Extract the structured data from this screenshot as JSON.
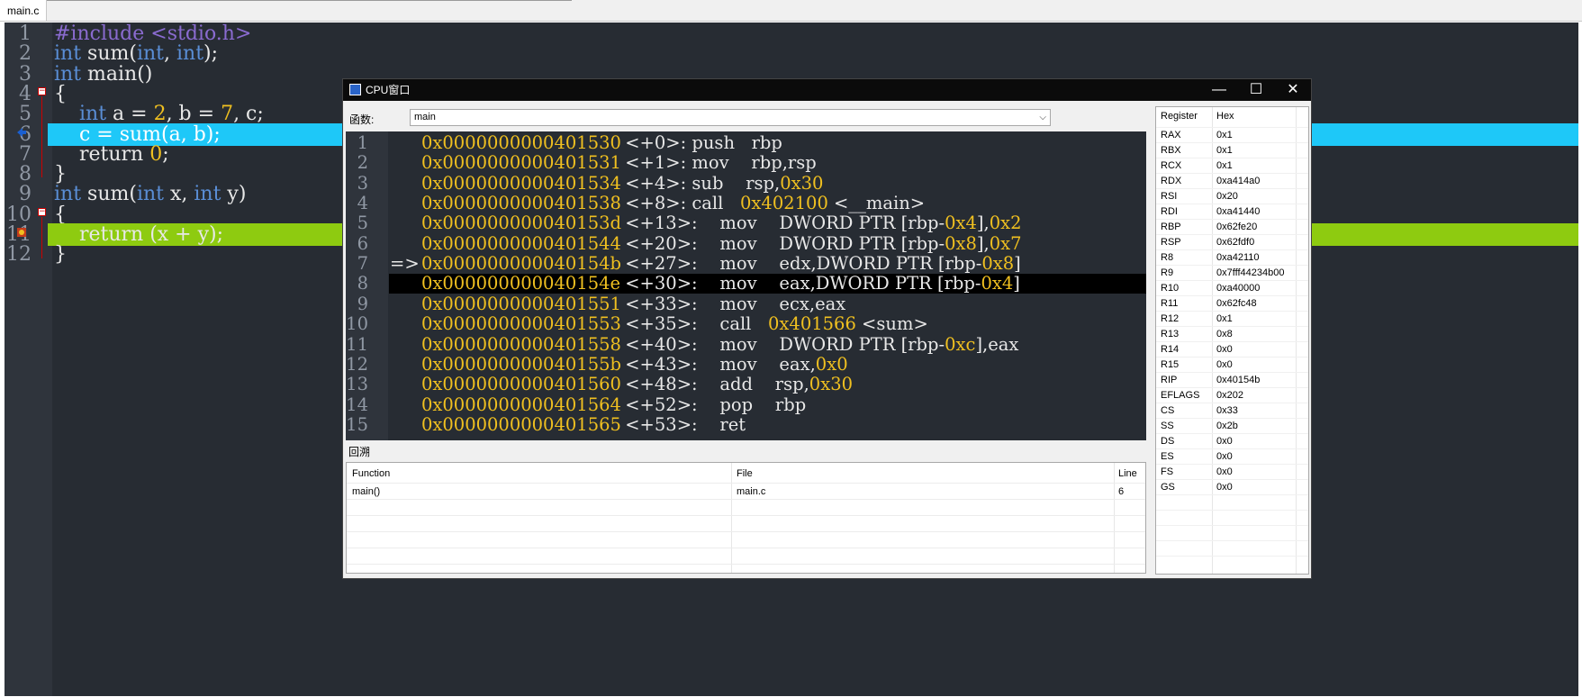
{
  "tab": {
    "label": "main.c"
  },
  "editor": {
    "lines": [
      {
        "n": "1",
        "parts": [
          [
            "pp",
            "#include "
          ],
          [
            "inc",
            "<stdio.h>"
          ]
        ]
      },
      {
        "n": "2",
        "parts": [
          [
            "kw",
            "int"
          ],
          [
            "t",
            " sum("
          ],
          [
            "kw",
            "int"
          ],
          [
            "t",
            ", "
          ],
          [
            "kw",
            "int"
          ],
          [
            "t",
            ");"
          ]
        ]
      },
      {
        "n": "3",
        "parts": [
          [
            "kw",
            "int"
          ],
          [
            "t",
            " main()"
          ]
        ]
      },
      {
        "n": "4",
        "parts": [
          [
            "t",
            "{"
          ]
        ]
      },
      {
        "n": "5",
        "parts": [
          [
            "t",
            "    "
          ],
          [
            "kw",
            "int"
          ],
          [
            "t",
            " a = "
          ],
          [
            "y",
            "2"
          ],
          [
            "t",
            ", b = "
          ],
          [
            "y",
            "7"
          ],
          [
            "t",
            ", c;"
          ]
        ]
      },
      {
        "n": "6",
        "parts": [
          [
            "t",
            "    c = sum(a, b);"
          ]
        ],
        "highlight": "blue"
      },
      {
        "n": "7",
        "parts": [
          [
            "t",
            "    return "
          ],
          [
            "y",
            "0"
          ],
          [
            "t",
            ";"
          ]
        ]
      },
      {
        "n": "8",
        "parts": [
          [
            "t",
            "}"
          ]
        ]
      },
      {
        "n": "9",
        "parts": [
          [
            "kw",
            "int"
          ],
          [
            "t",
            " sum("
          ],
          [
            "kw",
            "int"
          ],
          [
            "t",
            " x, "
          ],
          [
            "kw",
            "int"
          ],
          [
            "t",
            " y)"
          ]
        ]
      },
      {
        "n": "10",
        "parts": [
          [
            "t",
            "{"
          ]
        ]
      },
      {
        "n": "11",
        "parts": [
          [
            "t",
            "    return (x + y);"
          ]
        ],
        "highlight": "green"
      },
      {
        "n": "12",
        "parts": [
          [
            "t",
            "}"
          ]
        ]
      }
    ]
  },
  "cpu": {
    "title": "CPU窗口",
    "btn_min": "—",
    "btn_max": "☐",
    "btn_close": "✕",
    "func_label": "函数:",
    "func_value": "main",
    "asm": [
      {
        "n": "1",
        "mk": "",
        "addr": "0x0000000000401530",
        "rest": [
          [
            "t",
            " <+0>: push   rbp"
          ]
        ]
      },
      {
        "n": "2",
        "mk": "",
        "addr": "0x0000000000401531",
        "rest": [
          [
            "t",
            " <+1>: mov    rbp,rsp"
          ]
        ]
      },
      {
        "n": "3",
        "mk": "",
        "addr": "0x0000000000401534",
        "rest": [
          [
            "t",
            " <+4>: sub    rsp,"
          ],
          [
            "y",
            "0x30"
          ]
        ]
      },
      {
        "n": "4",
        "mk": "",
        "addr": "0x0000000000401538",
        "rest": [
          [
            "t",
            " <+8>: call   "
          ],
          [
            "y",
            "0x402100"
          ],
          [
            "t",
            " <__main>"
          ]
        ]
      },
      {
        "n": "5",
        "mk": "",
        "addr": "0x000000000040153d",
        "rest": [
          [
            "t",
            " <+13>:    mov    DWORD PTR [rbp-"
          ],
          [
            "y",
            "0x4"
          ],
          [
            "t",
            "],"
          ],
          [
            "y",
            "0x2"
          ]
        ]
      },
      {
        "n": "6",
        "mk": "",
        "addr": "0x0000000000401544",
        "rest": [
          [
            "t",
            " <+20>:    mov    DWORD PTR [rbp-"
          ],
          [
            "y",
            "0x8"
          ],
          [
            "t",
            "],"
          ],
          [
            "y",
            "0x7"
          ]
        ]
      },
      {
        "n": "7",
        "mk": "=>",
        "addr": "0x000000000040154b",
        "rest": [
          [
            "t",
            " <+27>:    mov    edx,DWORD PTR [rbp-"
          ],
          [
            "y",
            "0x8"
          ],
          [
            "t",
            "]"
          ]
        ]
      },
      {
        "n": "8",
        "mk": "",
        "addr": "0x000000000040154e",
        "rest": [
          [
            "t",
            " <+30>:    mov    eax,DWORD PTR [rbp-"
          ],
          [
            "y",
            "0x4"
          ],
          [
            "t",
            "]"
          ]
        ],
        "selected": true
      },
      {
        "n": "9",
        "mk": "",
        "addr": "0x0000000000401551",
        "rest": [
          [
            "t",
            " <+33>:    mov    ecx,eax"
          ]
        ]
      },
      {
        "n": "10",
        "mk": "",
        "addr": "0x0000000000401553",
        "rest": [
          [
            "t",
            " <+35>:    call   "
          ],
          [
            "y",
            "0x401566"
          ],
          [
            "t",
            " <sum>"
          ]
        ]
      },
      {
        "n": "11",
        "mk": "",
        "addr": "0x0000000000401558",
        "rest": [
          [
            "t",
            " <+40>:    mov    DWORD PTR [rbp-"
          ],
          [
            "y",
            "0xc"
          ],
          [
            "t",
            "],eax"
          ]
        ]
      },
      {
        "n": "12",
        "mk": "",
        "addr": "0x000000000040155b",
        "rest": [
          [
            "t",
            " <+43>:    mov    eax,"
          ],
          [
            "y",
            "0x0"
          ]
        ]
      },
      {
        "n": "13",
        "mk": "",
        "addr": "0x0000000000401560",
        "rest": [
          [
            "t",
            " <+48>:    add    rsp,"
          ],
          [
            "y",
            "0x30"
          ]
        ]
      },
      {
        "n": "14",
        "mk": "",
        "addr": "0x0000000000401564",
        "rest": [
          [
            "t",
            " <+52>:    pop    rbp"
          ]
        ]
      },
      {
        "n": "15",
        "mk": "",
        "addr": "0x0000000000401565",
        "rest": [
          [
            "t",
            " <+53>:    ret"
          ]
        ]
      }
    ],
    "backtrace": {
      "label": "回溯",
      "headers": [
        "Function",
        "File",
        "Line"
      ],
      "rows": [
        [
          "main()",
          "main.c",
          "6"
        ]
      ]
    },
    "registers": {
      "headers": [
        "Register",
        "Hex"
      ],
      "rows": [
        [
          "RAX",
          "0x1"
        ],
        [
          "RBX",
          "0x1"
        ],
        [
          "RCX",
          "0x1"
        ],
        [
          "RDX",
          "0xa414a0"
        ],
        [
          "RSI",
          "0x20"
        ],
        [
          "RDI",
          "0xa41440"
        ],
        [
          "RBP",
          "0x62fe20"
        ],
        [
          "RSP",
          "0x62fdf0"
        ],
        [
          "R8",
          "0xa42110"
        ],
        [
          "R9",
          "0x7fff44234b00"
        ],
        [
          "R10",
          "0xa40000"
        ],
        [
          "R11",
          "0x62fc48"
        ],
        [
          "R12",
          "0x1"
        ],
        [
          "R13",
          "0x8"
        ],
        [
          "R14",
          "0x0"
        ],
        [
          "R15",
          "0x0"
        ],
        [
          "RIP",
          "0x40154b"
        ],
        [
          "EFLAGS",
          "0x202"
        ],
        [
          "CS",
          "0x33"
        ],
        [
          "SS",
          "0x2b"
        ],
        [
          "DS",
          "0x0"
        ],
        [
          "ES",
          "0x0"
        ],
        [
          "FS",
          "0x0"
        ],
        [
          "GS",
          "0x0"
        ]
      ]
    }
  }
}
